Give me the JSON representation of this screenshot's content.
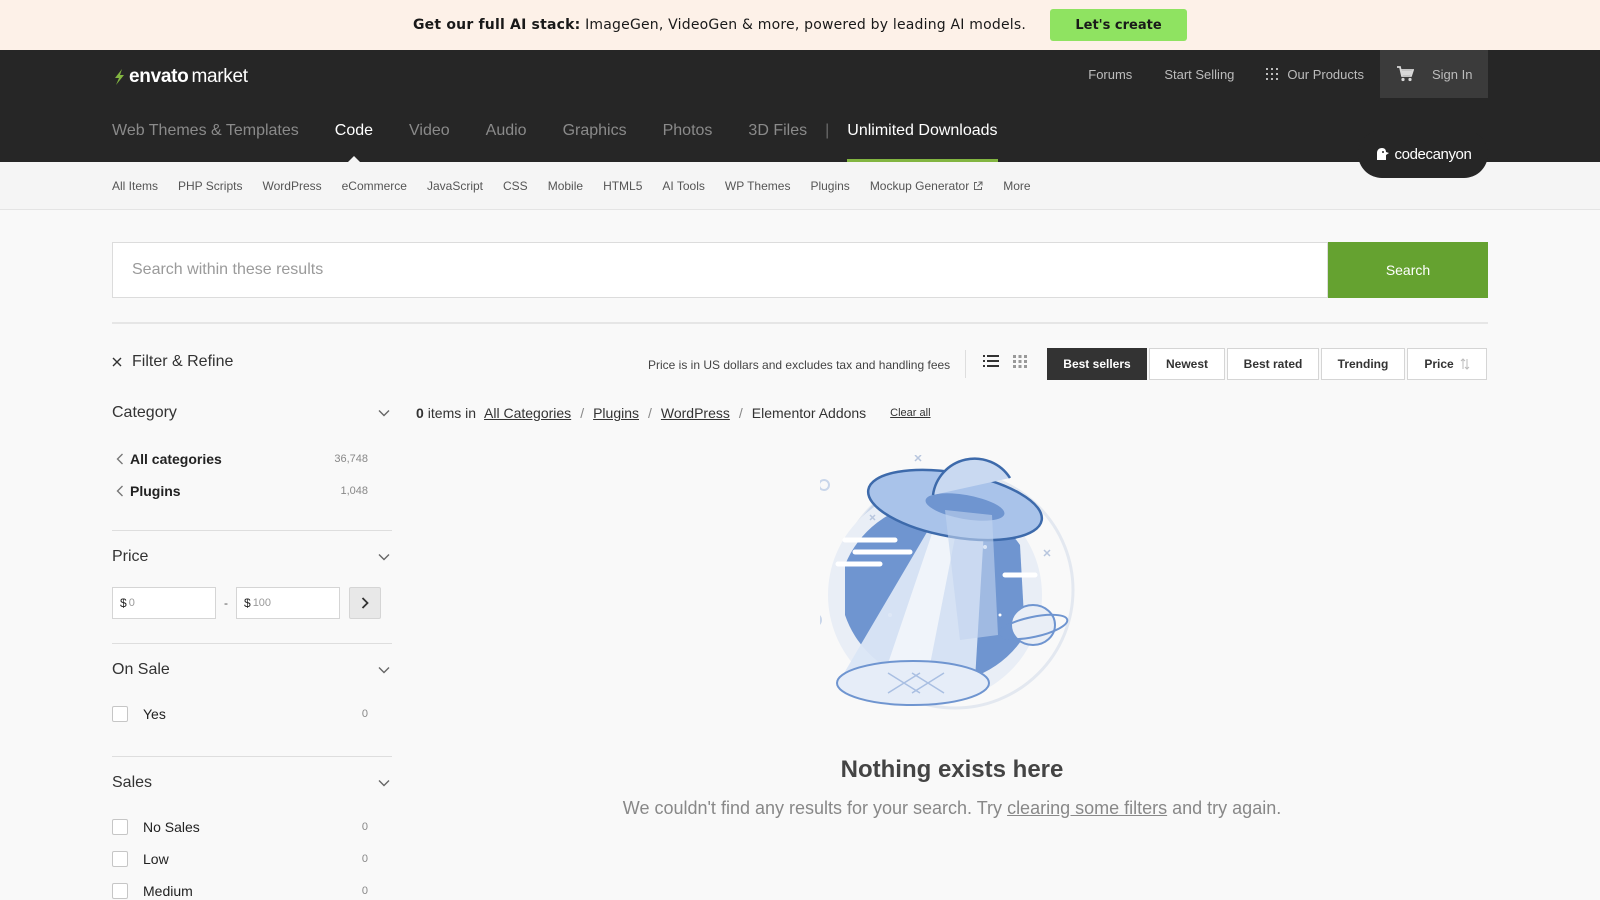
{
  "promo": {
    "bold_text": "Get our full AI stack:",
    "text": "ImageGen, VideoGen & more, powered by leading AI models.",
    "cta": "Let's create"
  },
  "header": {
    "logo_word": "envato",
    "logo_market": "market",
    "top_links": {
      "forums": "Forums",
      "start_selling": "Start Selling",
      "our_products": "Our Products",
      "sign_in": "Sign In"
    },
    "main_nav": [
      "Web Themes & Templates",
      "Code",
      "Video",
      "Audio",
      "Graphics",
      "Photos",
      "3D Files"
    ],
    "main_nav_active": "Code",
    "separator": "|",
    "unlimited": "Unlimited Downloads",
    "badge": "codecanyon",
    "accent_color": "#82b541"
  },
  "subnav": [
    "All Items",
    "PHP Scripts",
    "WordPress",
    "eCommerce",
    "JavaScript",
    "CSS",
    "Mobile",
    "HTML5",
    "AI Tools",
    "WP Themes",
    "Plugins",
    "Mockup Generator",
    "More"
  ],
  "search": {
    "placeholder": "Search within these results",
    "button": "Search",
    "button_color": "#65a230"
  },
  "sidebar": {
    "filter_title": "Filter & Refine",
    "category": {
      "title": "Category",
      "items": [
        {
          "label": "All categories",
          "count": "36,748"
        },
        {
          "label": "Plugins",
          "count": "1,048"
        }
      ]
    },
    "price": {
      "title": "Price",
      "symbol": "$",
      "min_placeholder": "0",
      "max_placeholder": "100",
      "dash": "-"
    },
    "on_sale": {
      "title": "On Sale",
      "options": [
        {
          "label": "Yes",
          "count": "0"
        }
      ]
    },
    "sales": {
      "title": "Sales",
      "options": [
        {
          "label": "No Sales",
          "count": "0"
        },
        {
          "label": "Low",
          "count": "0"
        },
        {
          "label": "Medium",
          "count": "0"
        }
      ]
    }
  },
  "results": {
    "price_note": "Price is in US dollars and excludes tax and handling fees",
    "sort": [
      "Best sellers",
      "Newest",
      "Best rated",
      "Trending",
      "Price"
    ],
    "sort_active": "Best sellers",
    "count": "0",
    "items_in": "items in",
    "breadcrumb": [
      "All Categories",
      "Plugins",
      "WordPress"
    ],
    "breadcrumb_current": "Elementor Addons",
    "breadcrumb_sep": "/",
    "clear_all": "Clear all"
  },
  "empty": {
    "title": "Nothing exists here",
    "msg_before": "We couldn't find any results for your search. Try",
    "msg_link": "clearing some filters",
    "msg_after": "and try again."
  }
}
